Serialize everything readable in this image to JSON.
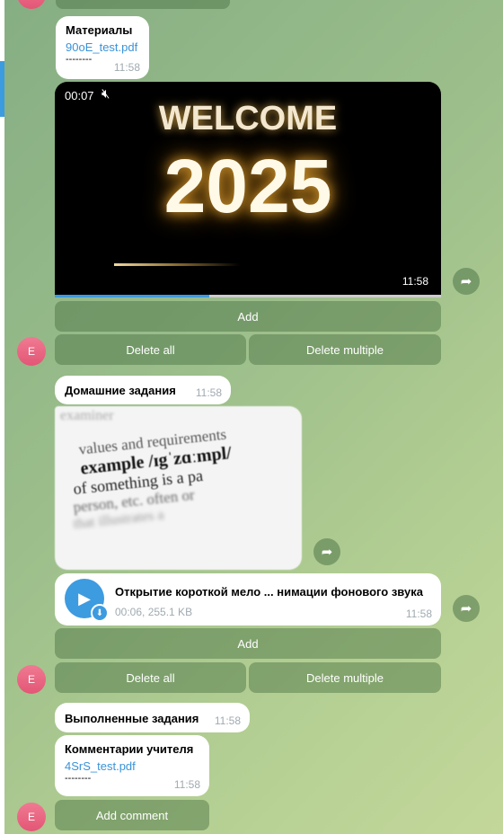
{
  "materials": {
    "title": "Материалы",
    "file": "90oE_test.pdf",
    "sep": "--------",
    "time": "11:58"
  },
  "video": {
    "elapsed": "00:07",
    "headline": "WELCOME",
    "year": "2025",
    "time": "11:58",
    "progress": 0.4
  },
  "buttons": {
    "add": "Add",
    "delete_all": "Delete all",
    "delete_multiple": "Delete multiple",
    "add_comment": "Add comment"
  },
  "avatar_letter": "E",
  "homework": {
    "title": "Домашние задания",
    "time": "11:58",
    "image_words": [
      "examiner",
      "values and requirements",
      "example /ɪgˈzɑːmpl/",
      "of something is a pa",
      "person, etc. often or",
      "that illustrates a"
    ]
  },
  "audio": {
    "title": "Открытие короткой мело ... нимации фонового звука",
    "meta": "00:06, 255.1 KB",
    "time": "11:58"
  },
  "done": {
    "title": "Выполненные задания",
    "time": "11:58"
  },
  "comments": {
    "title": "Комментарии учителя",
    "file": "4SrS_test.pdf",
    "sep": "--------",
    "time": "11:58"
  }
}
